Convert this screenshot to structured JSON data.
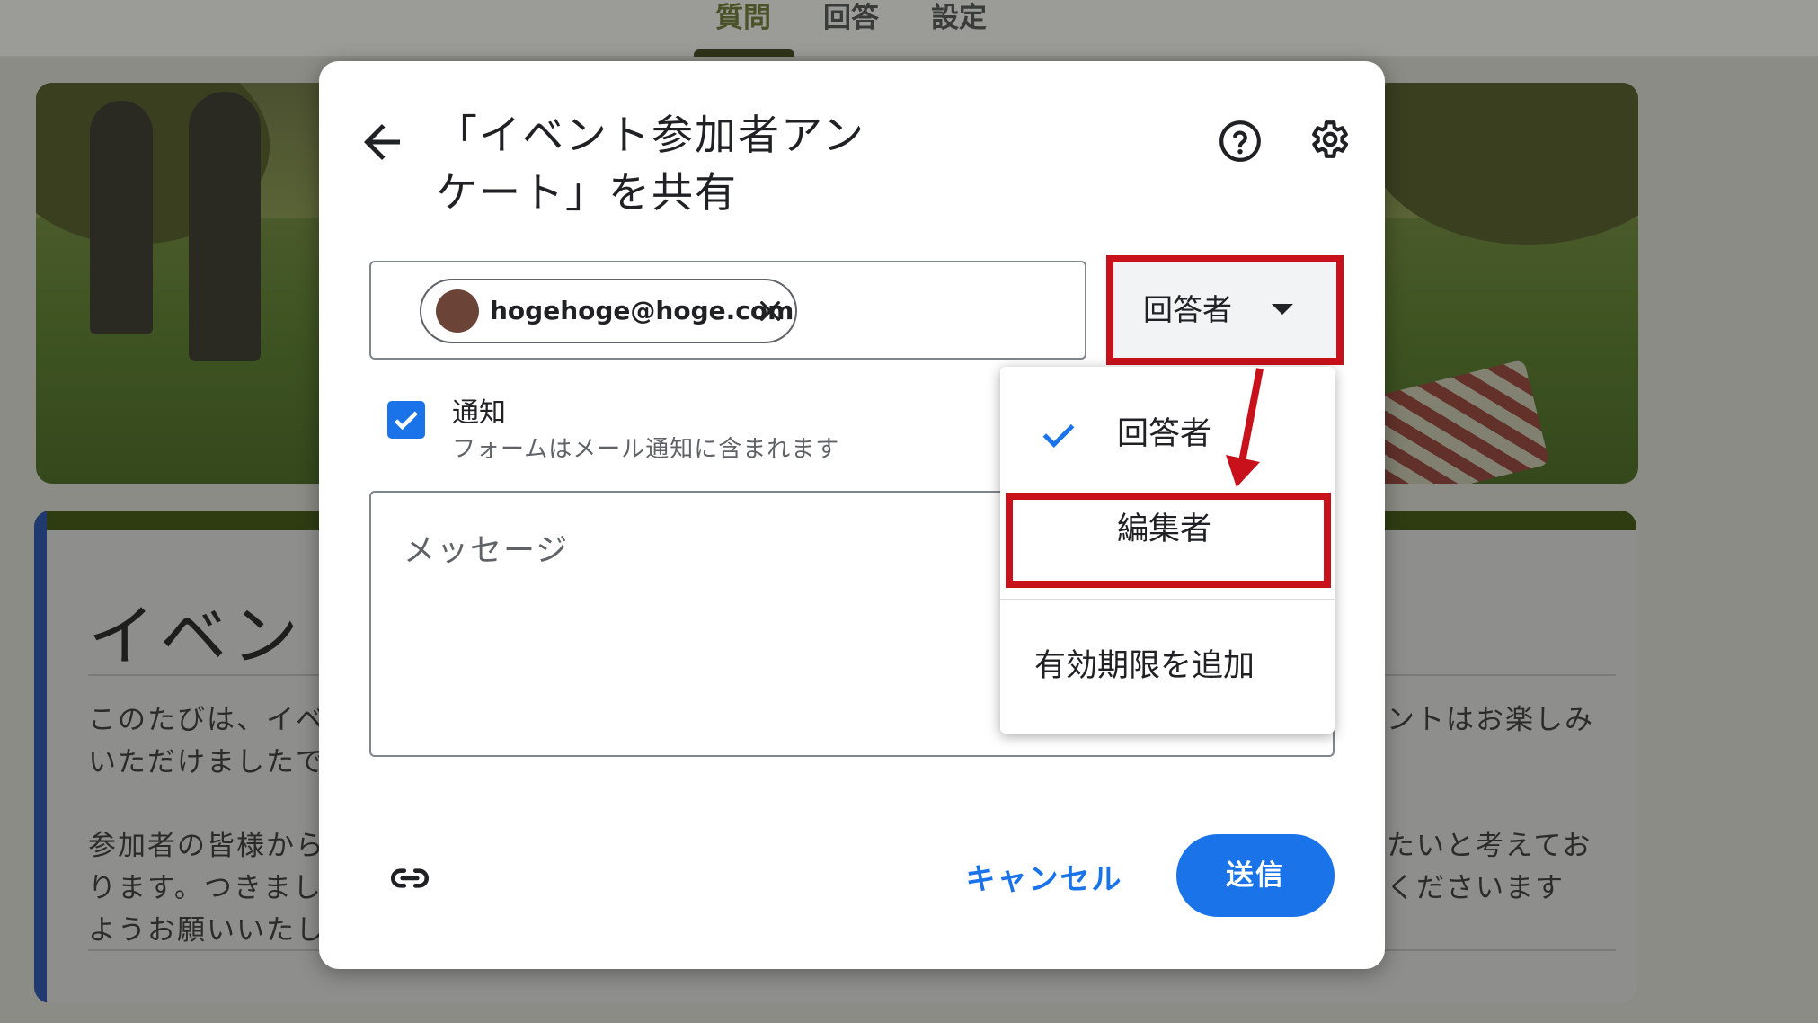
{
  "topbar": {
    "tabs": [
      {
        "label": "質問",
        "active": true
      },
      {
        "label": "回答",
        "active": false
      },
      {
        "label": "設定",
        "active": false
      }
    ]
  },
  "background_card": {
    "title": "イベント",
    "text_left": [
      "このたびは、イベ",
      "いただけましたで",
      "参加者の皆様から",
      "ります。つきまし",
      "ようお願いいたし"
    ],
    "text_right": [
      "ントはお楽しみ",
      "たいと考えてお",
      "くださいます"
    ]
  },
  "dialog": {
    "title": "「イベント参加者アンケート」を共有",
    "recipient": {
      "email": "hogehoge@hoge.com"
    },
    "role_button": {
      "label": "回答者"
    },
    "notify": {
      "checked": true,
      "label": "通知",
      "sublabel": "フォームはメール通知に含まれます"
    },
    "message": {
      "placeholder": "メッセージ"
    },
    "actions": {
      "cancel_label": "キャンセル",
      "send_label": "送信"
    }
  },
  "role_menu": {
    "items": [
      {
        "label": "回答者",
        "selected": true
      },
      {
        "label": "編集者",
        "selected": false
      },
      {
        "label": "有効期限を追加",
        "selected": false
      }
    ]
  },
  "colors": {
    "primary": "#1a73e8",
    "highlight": "#c9111c",
    "avatar": "#6b4437"
  },
  "icons": [
    "back-arrow-icon",
    "help-icon",
    "gear-icon",
    "close-icon",
    "check-icon",
    "link-icon",
    "chevron-down-icon"
  ]
}
